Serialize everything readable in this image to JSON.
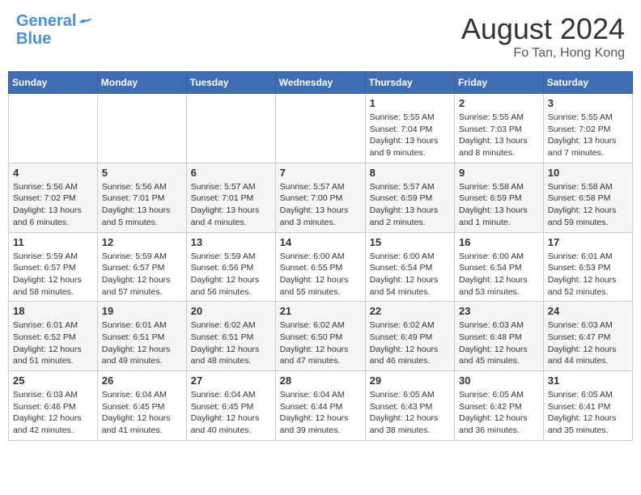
{
  "header": {
    "logo_line1": "General",
    "logo_line2": "Blue",
    "month": "August 2024",
    "location": "Fo Tan, Hong Kong"
  },
  "weekdays": [
    "Sunday",
    "Monday",
    "Tuesday",
    "Wednesday",
    "Thursday",
    "Friday",
    "Saturday"
  ],
  "weeks": [
    [
      {
        "day": "",
        "info": ""
      },
      {
        "day": "",
        "info": ""
      },
      {
        "day": "",
        "info": ""
      },
      {
        "day": "",
        "info": ""
      },
      {
        "day": "1",
        "info": "Sunrise: 5:55 AM\nSunset: 7:04 PM\nDaylight: 13 hours\nand 9 minutes."
      },
      {
        "day": "2",
        "info": "Sunrise: 5:55 AM\nSunset: 7:03 PM\nDaylight: 13 hours\nand 8 minutes."
      },
      {
        "day": "3",
        "info": "Sunrise: 5:55 AM\nSunset: 7:02 PM\nDaylight: 13 hours\nand 7 minutes."
      }
    ],
    [
      {
        "day": "4",
        "info": "Sunrise: 5:56 AM\nSunset: 7:02 PM\nDaylight: 13 hours\nand 6 minutes."
      },
      {
        "day": "5",
        "info": "Sunrise: 5:56 AM\nSunset: 7:01 PM\nDaylight: 13 hours\nand 5 minutes."
      },
      {
        "day": "6",
        "info": "Sunrise: 5:57 AM\nSunset: 7:01 PM\nDaylight: 13 hours\nand 4 minutes."
      },
      {
        "day": "7",
        "info": "Sunrise: 5:57 AM\nSunset: 7:00 PM\nDaylight: 13 hours\nand 3 minutes."
      },
      {
        "day": "8",
        "info": "Sunrise: 5:57 AM\nSunset: 6:59 PM\nDaylight: 13 hours\nand 2 minutes."
      },
      {
        "day": "9",
        "info": "Sunrise: 5:58 AM\nSunset: 6:59 PM\nDaylight: 13 hours\nand 1 minute."
      },
      {
        "day": "10",
        "info": "Sunrise: 5:58 AM\nSunset: 6:58 PM\nDaylight: 12 hours\nand 59 minutes."
      }
    ],
    [
      {
        "day": "11",
        "info": "Sunrise: 5:59 AM\nSunset: 6:57 PM\nDaylight: 12 hours\nand 58 minutes."
      },
      {
        "day": "12",
        "info": "Sunrise: 5:59 AM\nSunset: 6:57 PM\nDaylight: 12 hours\nand 57 minutes."
      },
      {
        "day": "13",
        "info": "Sunrise: 5:59 AM\nSunset: 6:56 PM\nDaylight: 12 hours\nand 56 minutes."
      },
      {
        "day": "14",
        "info": "Sunrise: 6:00 AM\nSunset: 6:55 PM\nDaylight: 12 hours\nand 55 minutes."
      },
      {
        "day": "15",
        "info": "Sunrise: 6:00 AM\nSunset: 6:54 PM\nDaylight: 12 hours\nand 54 minutes."
      },
      {
        "day": "16",
        "info": "Sunrise: 6:00 AM\nSunset: 6:54 PM\nDaylight: 12 hours\nand 53 minutes."
      },
      {
        "day": "17",
        "info": "Sunrise: 6:01 AM\nSunset: 6:53 PM\nDaylight: 12 hours\nand 52 minutes."
      }
    ],
    [
      {
        "day": "18",
        "info": "Sunrise: 6:01 AM\nSunset: 6:52 PM\nDaylight: 12 hours\nand 51 minutes."
      },
      {
        "day": "19",
        "info": "Sunrise: 6:01 AM\nSunset: 6:51 PM\nDaylight: 12 hours\nand 49 minutes."
      },
      {
        "day": "20",
        "info": "Sunrise: 6:02 AM\nSunset: 6:51 PM\nDaylight: 12 hours\nand 48 minutes."
      },
      {
        "day": "21",
        "info": "Sunrise: 6:02 AM\nSunset: 6:50 PM\nDaylight: 12 hours\nand 47 minutes."
      },
      {
        "day": "22",
        "info": "Sunrise: 6:02 AM\nSunset: 6:49 PM\nDaylight: 12 hours\nand 46 minutes."
      },
      {
        "day": "23",
        "info": "Sunrise: 6:03 AM\nSunset: 6:48 PM\nDaylight: 12 hours\nand 45 minutes."
      },
      {
        "day": "24",
        "info": "Sunrise: 6:03 AM\nSunset: 6:47 PM\nDaylight: 12 hours\nand 44 minutes."
      }
    ],
    [
      {
        "day": "25",
        "info": "Sunrise: 6:03 AM\nSunset: 6:46 PM\nDaylight: 12 hours\nand 42 minutes."
      },
      {
        "day": "26",
        "info": "Sunrise: 6:04 AM\nSunset: 6:45 PM\nDaylight: 12 hours\nand 41 minutes."
      },
      {
        "day": "27",
        "info": "Sunrise: 6:04 AM\nSunset: 6:45 PM\nDaylight: 12 hours\nand 40 minutes."
      },
      {
        "day": "28",
        "info": "Sunrise: 6:04 AM\nSunset: 6:44 PM\nDaylight: 12 hours\nand 39 minutes."
      },
      {
        "day": "29",
        "info": "Sunrise: 6:05 AM\nSunset: 6:43 PM\nDaylight: 12 hours\nand 38 minutes."
      },
      {
        "day": "30",
        "info": "Sunrise: 6:05 AM\nSunset: 6:42 PM\nDaylight: 12 hours\nand 36 minutes."
      },
      {
        "day": "31",
        "info": "Sunrise: 6:05 AM\nSunset: 6:41 PM\nDaylight: 12 hours\nand 35 minutes."
      }
    ]
  ]
}
